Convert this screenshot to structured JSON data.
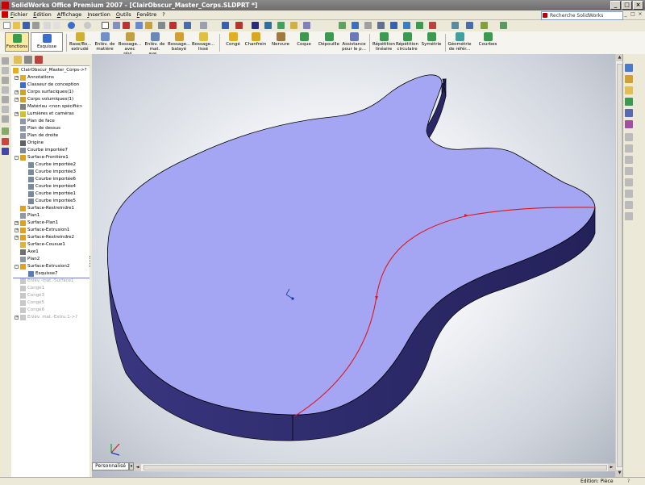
{
  "window": {
    "title": "SolidWorks Office Premium 2007 - [ClairObscur_Master_Corps.SLDPRT *]",
    "minimize": "_",
    "maximize": "□",
    "close": "×"
  },
  "menubar": {
    "items": [
      "Fichier",
      "Edition",
      "Affichage",
      "Insertion",
      "Outils",
      "Fenêtre",
      "?"
    ],
    "search_placeholder": "Recherche SolidWorks",
    "mdi_min": "_",
    "mdi_max": "□",
    "mdi_close": "×"
  },
  "command_manager": {
    "tab_features": "Fonctions",
    "tab_sketch": "Esquisse",
    "buttons": [
      {
        "label1": "Base/Bo...",
        "label2": "extrudé"
      },
      {
        "label1": "Enlèv. de",
        "label2": "matière ..."
      },
      {
        "label1": "Bossage...",
        "label2": "avec révi..."
      },
      {
        "label1": "Enlèv. de",
        "label2": "mat. ave..."
      },
      {
        "label1": "Bossage...",
        "label2": "balayé"
      },
      {
        "label1": "Bossage...",
        "label2": "lissé"
      },
      {
        "label1": "Congé",
        "label2": ""
      },
      {
        "label1": "Chanfrein",
        "label2": ""
      },
      {
        "label1": "Nervure",
        "label2": ""
      },
      {
        "label1": "Coque",
        "label2": ""
      },
      {
        "label1": "Dépouille",
        "label2": ""
      },
      {
        "label1": "Assistance",
        "label2": "pour le p..."
      },
      {
        "label1": "Répétition",
        "label2": "linéaire"
      },
      {
        "label1": "Répétition",
        "label2": "circulaire"
      },
      {
        "label1": "Symétrie",
        "label2": ""
      },
      {
        "label1": "Géométrie",
        "label2": "de référ..."
      },
      {
        "label1": "Courbes",
        "label2": ""
      }
    ]
  },
  "feature_tree": {
    "root": "ClairObscur_Master_Corps->?",
    "items": [
      {
        "label": "Annotations",
        "indent": 1,
        "expander": "+",
        "icon": "annotation-icon",
        "state": "normal"
      },
      {
        "label": "Classeur de conception",
        "indent": 1,
        "expander": "",
        "icon": "design-binder-icon",
        "state": "normal"
      },
      {
        "label": "Corps surfaciques(1)",
        "indent": 1,
        "expander": "+",
        "icon": "surface-bodies-icon",
        "state": "normal"
      },
      {
        "label": "Corps volumiques(1)",
        "indent": 1,
        "expander": "+",
        "icon": "solid-bodies-icon",
        "state": "normal"
      },
      {
        "label": "Matériau <non spécifié>",
        "indent": 1,
        "expander": "",
        "icon": "material-icon",
        "state": "normal"
      },
      {
        "label": "Lumières et caméras",
        "indent": 1,
        "expander": "+",
        "icon": "lights-icon",
        "state": "normal"
      },
      {
        "label": "Plan de face",
        "indent": 1,
        "expander": "",
        "icon": "plane-icon",
        "state": "normal"
      },
      {
        "label": "Plan de dessus",
        "indent": 1,
        "expander": "",
        "icon": "plane-icon",
        "state": "normal"
      },
      {
        "label": "Plan de droite",
        "indent": 1,
        "expander": "",
        "icon": "plane-icon",
        "state": "normal"
      },
      {
        "label": "Origine",
        "indent": 1,
        "expander": "",
        "icon": "origin-icon",
        "state": "normal"
      },
      {
        "label": "Courbe importée7",
        "indent": 1,
        "expander": "",
        "icon": "curve-icon",
        "state": "normal"
      },
      {
        "label": "Surface-Frontière1",
        "indent": 1,
        "expander": "-",
        "icon": "surface-feature-icon",
        "state": "normal"
      },
      {
        "label": "Courbe importée2",
        "indent": 2,
        "expander": "",
        "icon": "curve-icon",
        "state": "normal"
      },
      {
        "label": "Courbe importée3",
        "indent": 2,
        "expander": "",
        "icon": "curve-icon",
        "state": "normal"
      },
      {
        "label": "Courbe importée6",
        "indent": 2,
        "expander": "",
        "icon": "curve-icon",
        "state": "normal"
      },
      {
        "label": "Courbe importée4",
        "indent": 2,
        "expander": "",
        "icon": "curve-icon",
        "state": "normal"
      },
      {
        "label": "Courbe importée1",
        "indent": 2,
        "expander": "",
        "icon": "curve-icon",
        "state": "normal"
      },
      {
        "label": "Courbe importée5",
        "indent": 2,
        "expander": "",
        "icon": "curve-icon",
        "state": "normal"
      },
      {
        "label": "Surface-Restreindre1",
        "indent": 1,
        "expander": "",
        "icon": "surface-feature-icon",
        "state": "normal"
      },
      {
        "label": "Plan1",
        "indent": 1,
        "expander": "",
        "icon": "plane-icon",
        "state": "normal"
      },
      {
        "label": "Surface-Plan1",
        "indent": 1,
        "expander": "+",
        "icon": "surface-feature-icon",
        "state": "normal"
      },
      {
        "label": "Surface-Extrusion1",
        "indent": 1,
        "expander": "+",
        "icon": "surface-feature-icon",
        "state": "normal"
      },
      {
        "label": "Surface-Restreindre2",
        "indent": 1,
        "expander": "+",
        "icon": "surface-feature-icon",
        "state": "normal"
      },
      {
        "label": "Surface-Cousue1",
        "indent": 1,
        "expander": "",
        "icon": "surface-knit-icon",
        "state": "normal"
      },
      {
        "label": "Axe1",
        "indent": 1,
        "expander": "",
        "icon": "axis-icon",
        "state": "normal"
      },
      {
        "label": "Plan2",
        "indent": 1,
        "expander": "",
        "icon": "plane-icon",
        "state": "normal"
      },
      {
        "label": "Surface-Extrusion2",
        "indent": 1,
        "expander": "-",
        "icon": "surface-feature-icon",
        "state": "normal"
      },
      {
        "label": "Esquisse7",
        "indent": 2,
        "expander": "",
        "icon": "sketch-icon",
        "state": "normal"
      },
      {
        "label": "Enlèv.-mat.-Surface1",
        "indent": 1,
        "expander": "",
        "icon": "cut-icon",
        "state": "disabled"
      },
      {
        "label": "Congé1",
        "indent": 1,
        "expander": "",
        "icon": "fillet-icon",
        "state": "disabled"
      },
      {
        "label": "Congé3",
        "indent": 1,
        "expander": "",
        "icon": "fillet-icon",
        "state": "disabled"
      },
      {
        "label": "Congé5",
        "indent": 1,
        "expander": "",
        "icon": "fillet-icon",
        "state": "disabled"
      },
      {
        "label": "Congé6",
        "indent": 1,
        "expander": "",
        "icon": "fillet-icon",
        "state": "disabled"
      },
      {
        "label": "Enlèv. mat.-Extru.1->?",
        "indent": 1,
        "expander": "+",
        "icon": "cut-icon",
        "state": "disabled"
      }
    ]
  },
  "bottom": {
    "config_tab": "Personnalisé",
    "config_drop": "▾",
    "status": "Edition: Pièce",
    "help": "?"
  },
  "colors": {
    "face_top": "#a4a6f4",
    "face_side": "#2e2b6c",
    "sketch_curve": "#e0161b",
    "title_bar": "#7a7a7a"
  }
}
